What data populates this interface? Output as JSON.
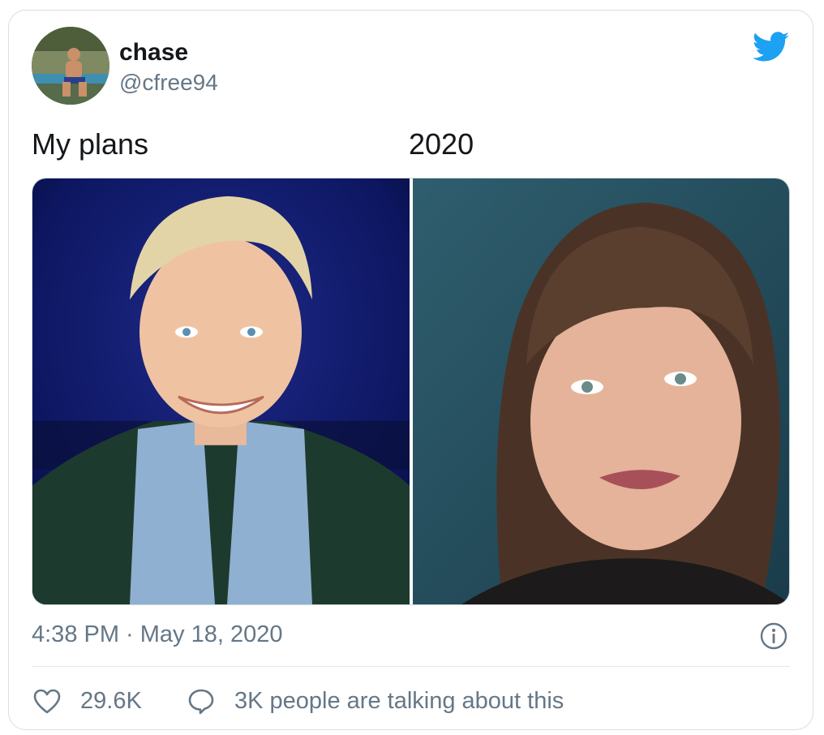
{
  "user": {
    "display_name": "chase",
    "handle": "@cfree94",
    "avatar_icon": "avatar-photo"
  },
  "brand": {
    "icon": "twitter-bird-icon",
    "color": "#1da1f2"
  },
  "tweet": {
    "text_left": "My plans",
    "text_right": "2020",
    "timestamp": "4:38 PM · May 18, 2020"
  },
  "media": {
    "left_photo": "portrait-photo",
    "right_photo": "portrait-photo"
  },
  "actions": {
    "like_icon": "heart-icon",
    "like_count": "29.6K",
    "reply_icon": "speech-bubble-icon",
    "talking_text": "3K people are talking about this",
    "info_icon": "info-icon"
  },
  "colors": {
    "text": "#14171a",
    "muted": "#657786",
    "border": "#d9dee3"
  }
}
